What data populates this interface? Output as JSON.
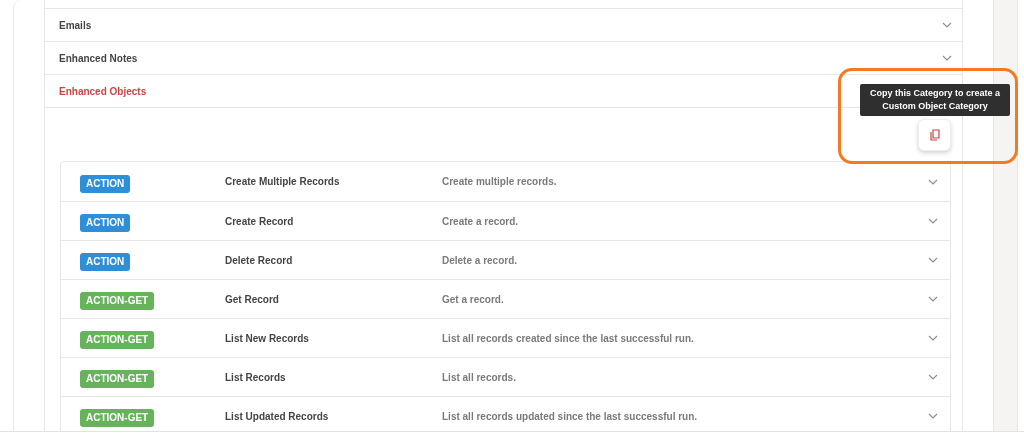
{
  "categories": [
    {
      "title": "Emails",
      "expanded": false
    },
    {
      "title": "Enhanced Notes",
      "expanded": false
    },
    {
      "title": "Enhanced Objects",
      "expanded": true
    }
  ],
  "copy_tooltip": "Copy this Category to create a Custom Object Category",
  "operations": [
    {
      "kind": "action",
      "badge": "ACTION",
      "name": "Create Multiple Records",
      "description": "Create multiple records."
    },
    {
      "kind": "action",
      "badge": "ACTION",
      "name": "Create Record",
      "description": "Create a record."
    },
    {
      "kind": "action",
      "badge": "ACTION",
      "name": "Delete Record",
      "description": "Delete a record."
    },
    {
      "kind": "action-get",
      "badge": "ACTION-GET",
      "name": "Get Record",
      "description": "Get a record."
    },
    {
      "kind": "action-get",
      "badge": "ACTION-GET",
      "name": "List New Records",
      "description": "List all records created since the last successful run."
    },
    {
      "kind": "action-get",
      "badge": "ACTION-GET",
      "name": "List Records",
      "description": "List all records."
    },
    {
      "kind": "action-get",
      "badge": "ACTION-GET",
      "name": "List Updated Records",
      "description": "List all records updated since the last successful run."
    }
  ]
}
